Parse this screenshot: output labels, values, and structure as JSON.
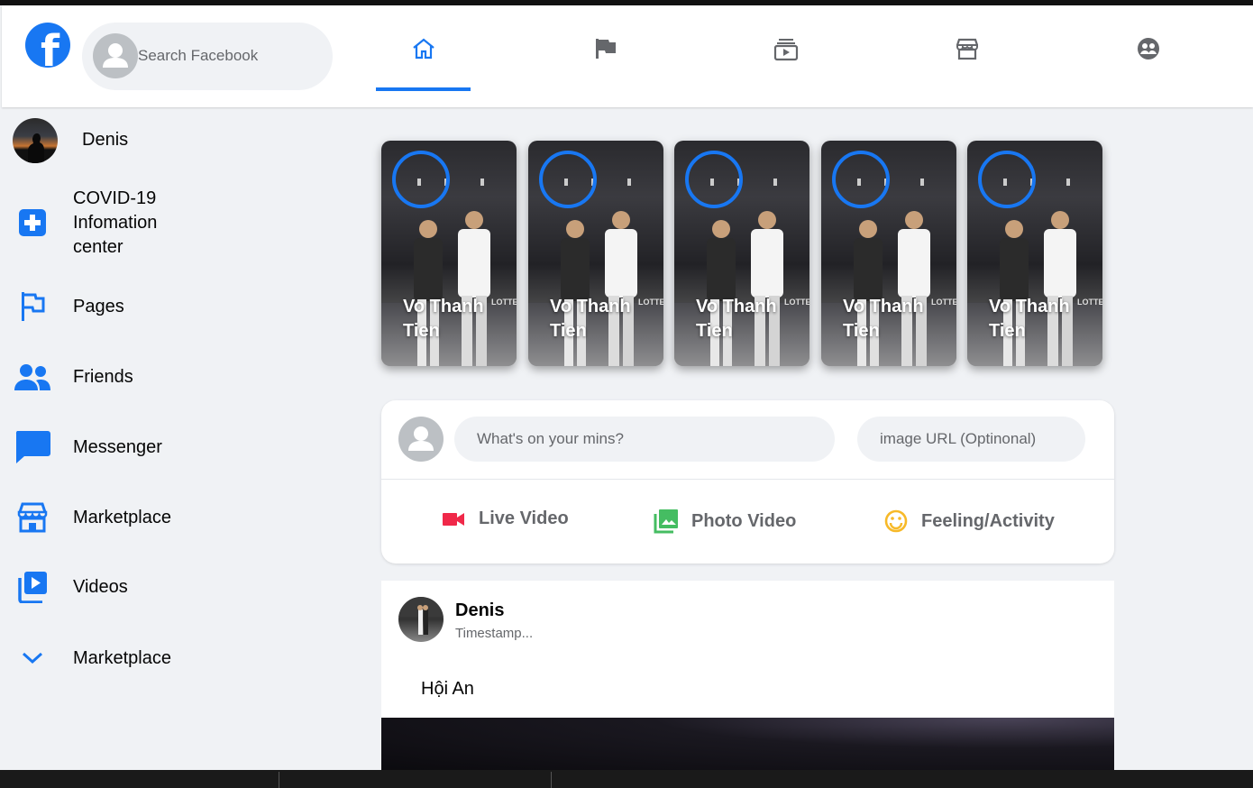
{
  "header": {
    "logo_letter": "f",
    "search_placeholder": "Search Facebook",
    "nav_tabs": [
      {
        "icon": "home-icon",
        "active": true
      },
      {
        "icon": "flag-icon",
        "active": false
      },
      {
        "icon": "watch-icon",
        "active": false
      },
      {
        "icon": "marketplace-icon",
        "active": false
      },
      {
        "icon": "groups-icon",
        "active": false
      }
    ]
  },
  "sidebar": {
    "items": [
      {
        "label": "Denis",
        "icon": "avatar"
      },
      {
        "label": "COVID-19 Infomation center",
        "icon": "plus-square-icon"
      },
      {
        "label": "Pages",
        "icon": "flag-icon"
      },
      {
        "label": "Friends",
        "icon": "people-icon"
      },
      {
        "label": "Messenger",
        "icon": "chat-icon"
      },
      {
        "label": "Marketplace",
        "icon": "store-icon"
      },
      {
        "label": "Videos",
        "icon": "video-library-icon"
      },
      {
        "label": "Marketplace",
        "icon": "chevron-down-icon"
      }
    ]
  },
  "stories": [
    {
      "name": "Vo Thanh Tien",
      "sign": "LOTTE"
    },
    {
      "name": "Vo Thanh Tien",
      "sign": "LOTTE"
    },
    {
      "name": "Vo Thanh Tien",
      "sign": "LOTTE"
    },
    {
      "name": "Vo Thanh Tien",
      "sign": "LOTTE"
    },
    {
      "name": "Vo Thanh Tien",
      "sign": "LOTTE"
    }
  ],
  "composer": {
    "message_placeholder": "What's on your mins?",
    "image_placeholder": "image URL (Optinonal)",
    "options": [
      {
        "label": "Live Video",
        "color": "#f02849"
      },
      {
        "label": "Photo Video",
        "color": "#45bd62"
      },
      {
        "label": "Feeling/Activity",
        "color": "#f7b928"
      }
    ]
  },
  "post": {
    "author": "Denis",
    "timestamp": "Timestamp...",
    "message": "Hội An"
  },
  "colors": {
    "accent": "#1877f2",
    "background": "#f0f2f5"
  }
}
